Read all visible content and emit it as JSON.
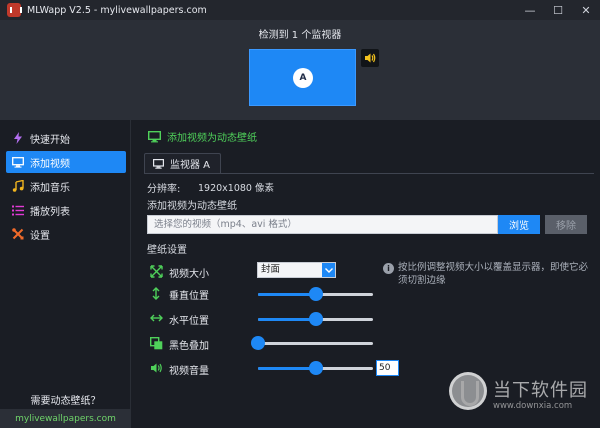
{
  "window": {
    "title": "MLWapp V2.5 - mylivewallpapers.com",
    "min_label": "—",
    "max_label": "☐",
    "close_label": "✕"
  },
  "monitor_panel": {
    "detected_label": "检测到 1 个监视器",
    "monitor_letter": "A"
  },
  "sidebar": {
    "items": [
      {
        "label": "快速开始",
        "icon": "lightning-icon",
        "color": "#b36ef0"
      },
      {
        "label": "添加视频",
        "icon": "monitor-icon",
        "color": "#ffffff",
        "active": true
      },
      {
        "label": "添加音乐",
        "icon": "music-icon",
        "color": "#f2b51f"
      },
      {
        "label": "播放列表",
        "icon": "list-icon",
        "color": "#e23ad6"
      },
      {
        "label": "设置",
        "icon": "tools-icon",
        "color": "#f06a2a"
      }
    ],
    "need_label": "需要动态壁纸？",
    "site_link": "mylivewallpapers.com"
  },
  "main": {
    "section_title": "添加视频为动态壁纸",
    "tab_label": "监视器 A",
    "resolution_label": "分辨率:",
    "resolution_value": "1920x1080 像素",
    "add_video_label": "添加视频为动态壁纸",
    "file_placeholder": "选择您的视频（mp4、avi 格式）",
    "browse_label": "浏览",
    "remove_label": "移除",
    "settings_title": "壁纸设置",
    "video_size_label": "视频大小",
    "video_size_value": "封面",
    "info_text": "按比例调整视频大小以覆盖显示器，即使它必须切割边缘",
    "vertical_label": "垂直位置",
    "horizontal_label": "水平位置",
    "black_overlay_label": "黑色叠加",
    "volume_label": "视频音量",
    "vertical_value": 50,
    "horizontal_value": 50,
    "black_overlay_value": 0,
    "volume_value": 50,
    "volume_text": "50"
  },
  "watermark": {
    "title": "当下软件园",
    "url": "www.downxia.com"
  },
  "colors": {
    "accent": "#1e88f5",
    "green_text": "#4fd15a"
  }
}
